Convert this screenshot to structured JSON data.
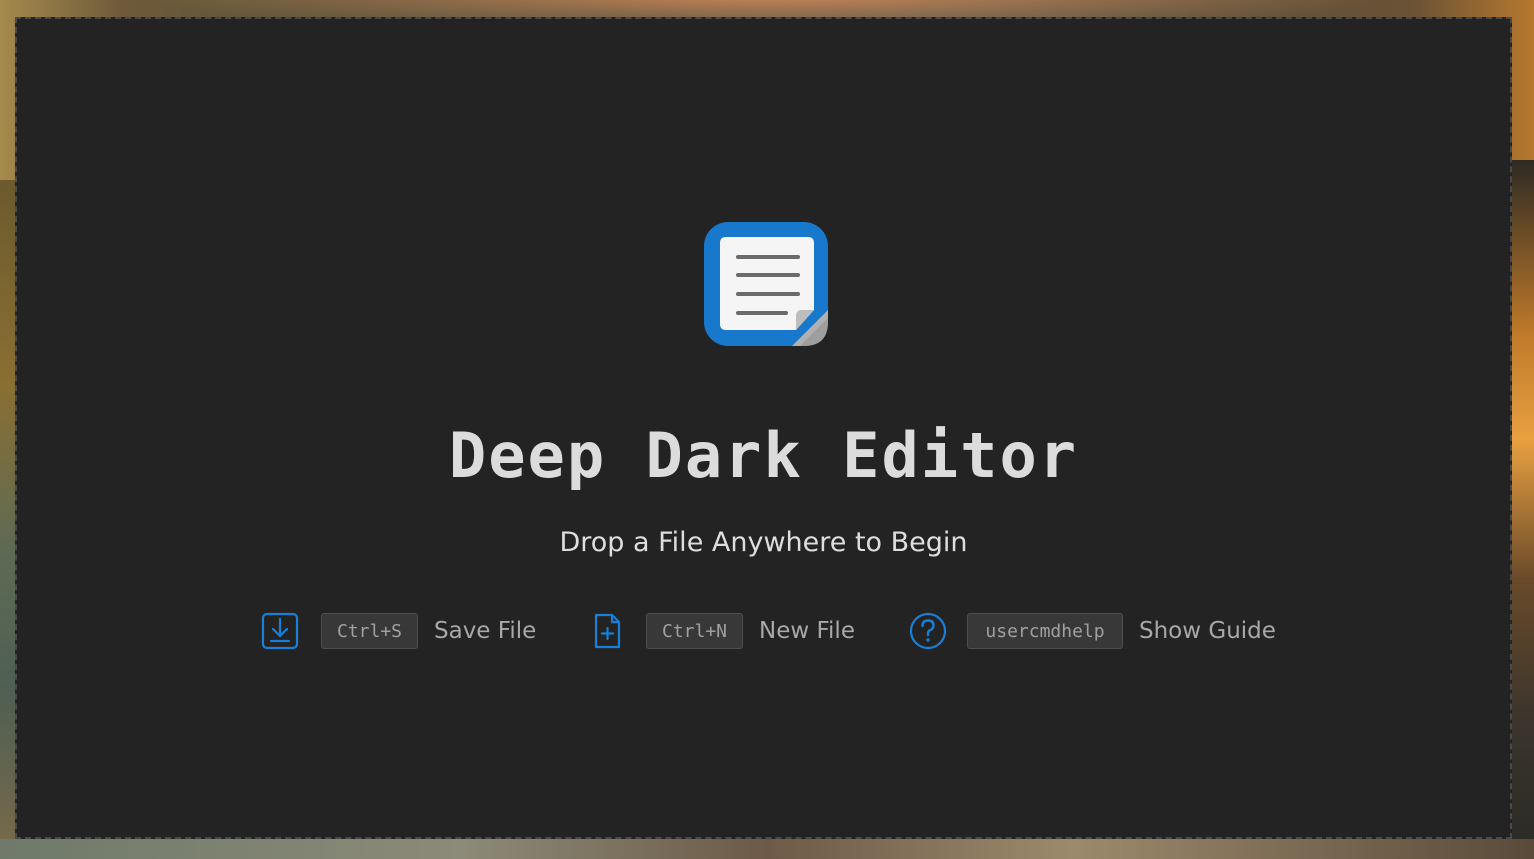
{
  "app": {
    "title": "Deep Dark Editor",
    "subtitle": "Drop a File Anywhere to Begin",
    "icon": "notepad-icon"
  },
  "shortcuts": [
    {
      "icon": "save-download-icon",
      "key": "Ctrl+S",
      "label": "Save File"
    },
    {
      "icon": "new-file-icon",
      "key": "Ctrl+N",
      "label": "New File"
    },
    {
      "icon": "help-circle-icon",
      "key": "usercmdhelp",
      "label": "Show Guide"
    }
  ],
  "colors": {
    "background": "#232323",
    "accent": "#1a7fd4",
    "title": "#dcdcdc",
    "muted_text": "#a8a8a8"
  }
}
